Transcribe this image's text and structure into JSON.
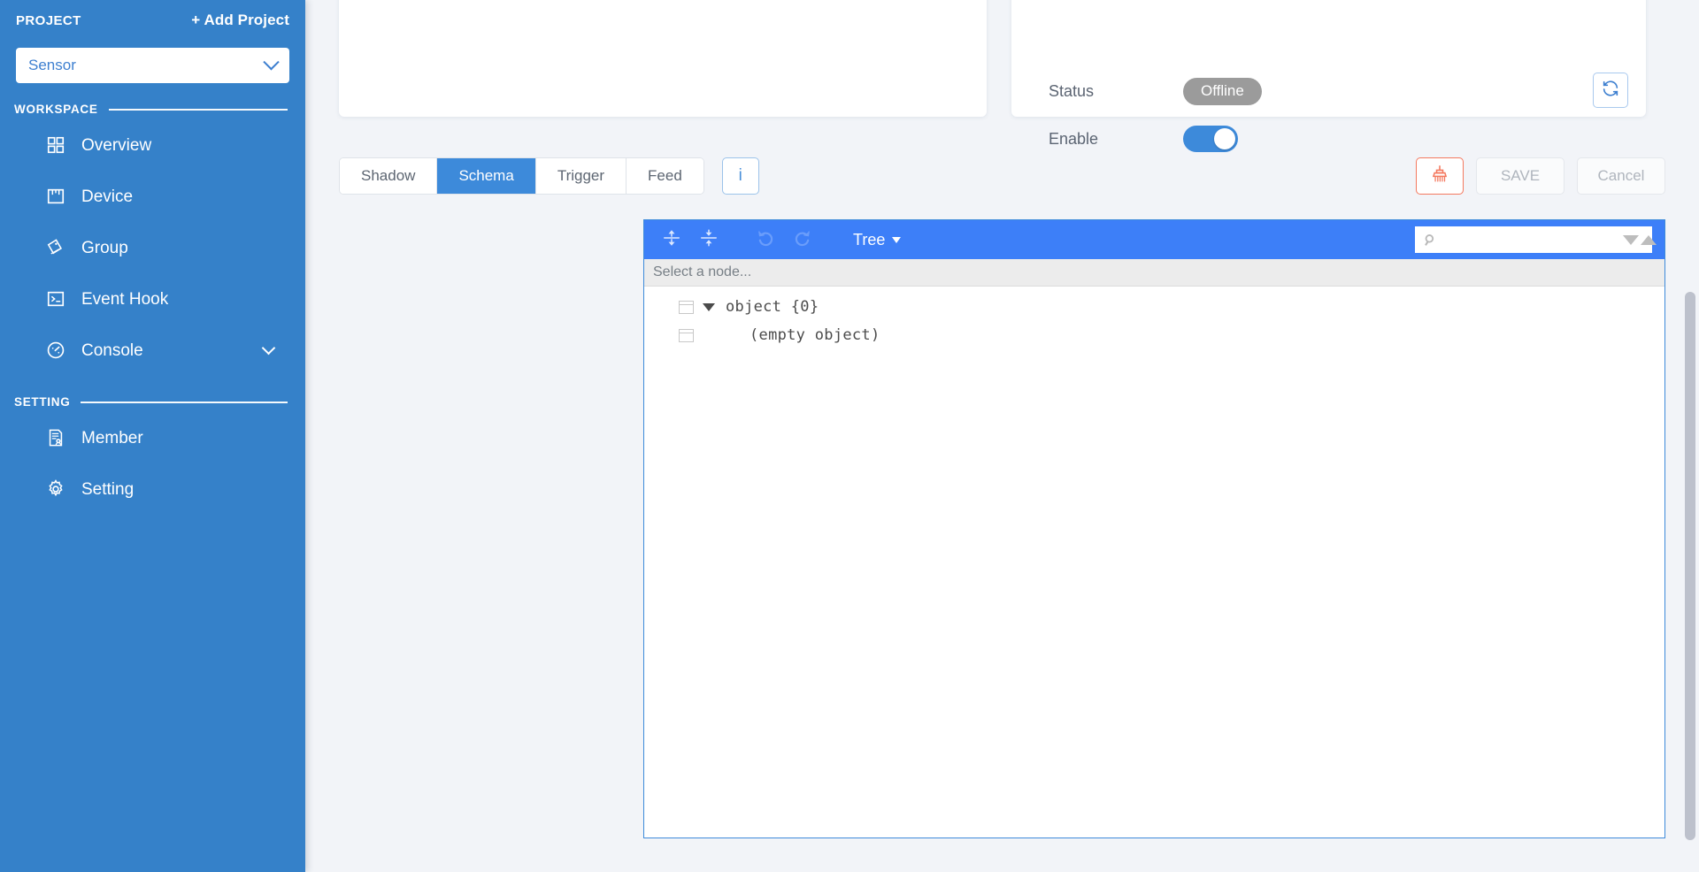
{
  "sidebar": {
    "project_label": "PROJECT",
    "add_project_label": "+ Add Project",
    "project_selected": "Sensor",
    "workspace_label": "WORKSPACE",
    "setting_label": "SETTING",
    "workspace_items": [
      {
        "label": "Overview",
        "icon": "grid-icon",
        "expandable": false
      },
      {
        "label": "Device",
        "icon": "device-icon",
        "expandable": false
      },
      {
        "label": "Group",
        "icon": "tag-icon",
        "expandable": false
      },
      {
        "label": "Event Hook",
        "icon": "terminal-icon",
        "expandable": false
      },
      {
        "label": "Console",
        "icon": "gauge-icon",
        "expandable": true
      }
    ],
    "setting_items": [
      {
        "label": "Member",
        "icon": "member-icon",
        "expandable": false
      },
      {
        "label": "Setting",
        "icon": "gear-icon",
        "expandable": false
      }
    ],
    "bg_color": "#3581c9"
  },
  "detail_card": {
    "status_label": "Status",
    "status_value": "Offline",
    "status_color": "#9b9b9b",
    "enable_label": "Enable",
    "enable_on": true,
    "toggle_color": "#3d8ada",
    "refresh_icon": "refresh-icon"
  },
  "tabs": {
    "items": [
      {
        "label": "Shadow",
        "active": false
      },
      {
        "label": "Schema",
        "active": true
      },
      {
        "label": "Trigger",
        "active": false
      },
      {
        "label": "Feed",
        "active": false
      }
    ],
    "info_label": "i",
    "active_color": "#3d8ada"
  },
  "actions": {
    "clean_icon": "broom-icon",
    "clean_color": "#f4795f",
    "save_label": "SAVE",
    "cancel_label": "Cancel",
    "disabled": true
  },
  "editor": {
    "header_color": "#3d7ff8",
    "border_color": "#3d8ada",
    "expand_all_icon": "expand-all-icon",
    "collapse_all_icon": "collapse-all-icon",
    "undo_icon": "undo-icon",
    "redo_icon": "redo-icon",
    "mode_label": "Tree",
    "search_placeholder": "",
    "search_value": "",
    "search_icon": "search-icon",
    "search_next_icon": "triangle-down-icon",
    "search_prev_icon": "triangle-up-icon",
    "node_path": "Select a node...",
    "tree_rows": [
      {
        "text": "object {0}",
        "expanded": true,
        "indent": 0
      },
      {
        "text": "(empty object)",
        "expanded": null,
        "indent": 1
      }
    ]
  }
}
